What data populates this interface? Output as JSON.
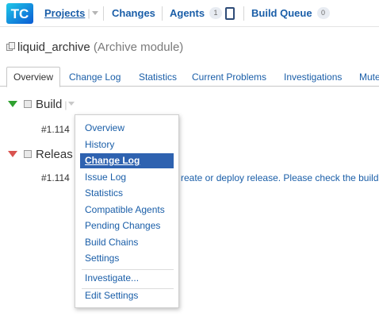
{
  "logo": {
    "text": "TC",
    "icon": "teamcity-logo",
    "colors": [
      "#0b5bd4",
      "#1ec8e8",
      "#ffffff"
    ]
  },
  "nav": {
    "projects": "Projects",
    "changes": "Changes",
    "agents": "Agents",
    "agents_count": "1",
    "build_queue": "Build Queue",
    "queue_count": "0"
  },
  "page": {
    "title": "liquid_archive",
    "subtitle": "(Archive module)"
  },
  "tabs": [
    "Overview",
    "Change Log",
    "Statistics",
    "Current Problems",
    "Investigations",
    "Mute"
  ],
  "configs": [
    {
      "name": "Build",
      "status": "success",
      "build": "#1.114"
    },
    {
      "name": "Releas",
      "status": "failed",
      "build": "#1.114",
      "message": "reate or deploy release. Please check the build"
    }
  ],
  "menu": {
    "items": [
      "Overview",
      "History",
      "Change Log",
      "Issue Log",
      "Statistics",
      "Compatible Agents",
      "Pending Changes",
      "Build Chains",
      "Settings"
    ],
    "extra": [
      "Investigate...",
      "Edit Settings"
    ],
    "selected": "Change Log"
  },
  "colors": {
    "link": "#1a5ea8",
    "success": "#2fa12f",
    "failed": "#d9534f",
    "highlight": "#2e62b0"
  }
}
